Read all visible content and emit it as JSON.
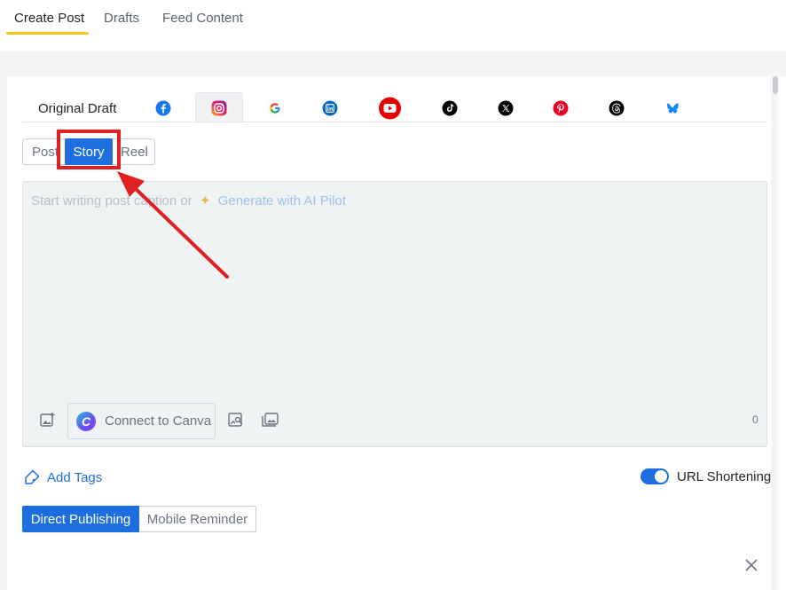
{
  "top_tabs": [
    {
      "label": "Create Post",
      "active": true
    },
    {
      "label": "Drafts",
      "active": false
    },
    {
      "label": "Feed Content",
      "active": false
    }
  ],
  "platform_tabs": {
    "original_draft": "Original Draft",
    "icons": [
      "facebook-icon",
      "instagram-icon",
      "google-business-icon",
      "linkedin-icon",
      "youtube-icon",
      "tiktok-icon",
      "x-icon",
      "pinterest-icon",
      "threads-icon",
      "bluesky-icon"
    ],
    "active": "instagram-icon"
  },
  "post_types": {
    "post": "Post",
    "story": "Story",
    "reel": "Reel",
    "selected": "Story"
  },
  "editor": {
    "placeholder": "Start writing post caption or",
    "ai_link": "Generate with AI Pilot",
    "canva_button": "Connect to Canva",
    "char_count": "0"
  },
  "tags": {
    "label": "Add Tags"
  },
  "url_shortening": {
    "label": "URL Shortening",
    "enabled": true
  },
  "publishing": {
    "direct": "Direct Publishing",
    "mobile": "Mobile Reminder",
    "selected": "Direct Publishing"
  },
  "colors": {
    "accent": "#1d6fe0",
    "tab_underline": "#f5c518",
    "annotation": "#e02020"
  }
}
